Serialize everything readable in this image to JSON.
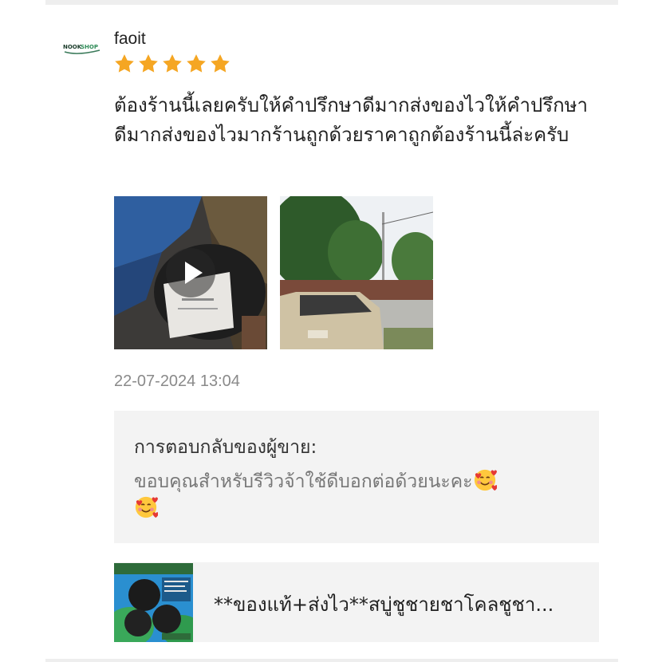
{
  "review": {
    "username": "faoit",
    "rating": 5,
    "rating_max": 5,
    "star_color": "#F5A623",
    "text": "ต้องร้านนี้เลยครับให้คำปรึกษาดีมากส่งของไวให้คำปรึกษาดีมากส่งของไวมากร้านถูกด้วยราคาถูกต้องร้านนี้ล่ะครับ",
    "timestamp": "22-07-2024 13:04",
    "media": [
      {
        "kind": "video",
        "icon": "play-icon"
      },
      {
        "kind": "photo"
      }
    ]
  },
  "seller_reply": {
    "title": "การตอบกลับของผู้ขาย:",
    "text": "ขอบคุณสำหรับรีวิวจ้าใช้ดีบอกต่อด้วยนะคะ",
    "emoji": "smiling-face-with-hearts"
  },
  "product": {
    "name": "**ของแท้+ส่งไว**สบู่ชูชายชาโคลชูชา..."
  }
}
